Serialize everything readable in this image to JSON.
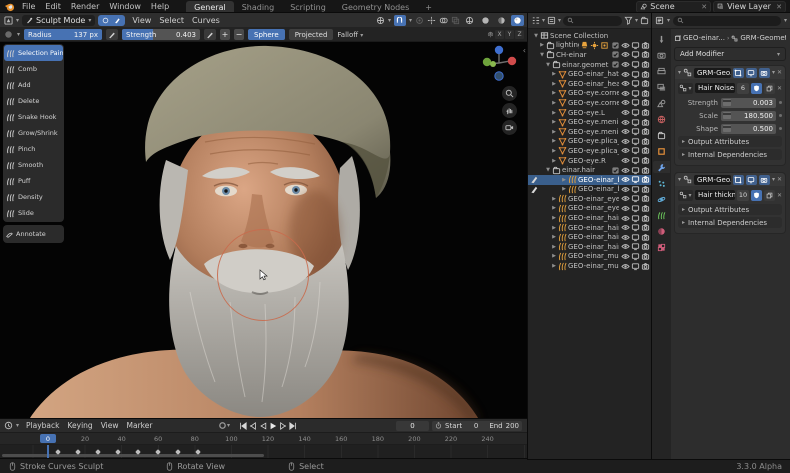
{
  "colors": {
    "accent": "#4772b3",
    "selection_row": "#3a5f8c",
    "brush_cursor": "#c96a4d",
    "object_orange": "#e8913a"
  },
  "topbar": {
    "menus": [
      "File",
      "Edit",
      "Render",
      "Window",
      "Help"
    ],
    "workspaces": [
      {
        "label": "General",
        "active": true
      },
      {
        "label": "Shading",
        "active": false
      },
      {
        "label": "Scripting",
        "active": false
      },
      {
        "label": "Geometry Nodes",
        "active": false
      },
      {
        "label": "+",
        "active": false
      }
    ],
    "scene": "Scene",
    "view_layer": "View Layer"
  },
  "viewport": {
    "mode": "Sculpt Mode",
    "menus": [
      "View",
      "Select",
      "Curves"
    ],
    "tool_settings": {
      "radius_label": "Radius",
      "radius_value": "137 px",
      "radius_fill": 1.0,
      "strength_label": "Strength",
      "strength_value": "0.403",
      "strength_fill": 0.4,
      "plus": "+",
      "minus": "−",
      "shape": "Sphere",
      "projection": "Projected",
      "falloff_label": "Falloff",
      "symmetry": [
        "X",
        "Y",
        "Z"
      ]
    },
    "toolbar": [
      {
        "label": "Selection Paint",
        "active": true
      },
      {
        "label": "Comb",
        "active": false
      },
      {
        "label": "Add",
        "active": false
      },
      {
        "label": "Delete",
        "active": false
      },
      {
        "label": "Snake Hook",
        "active": false
      },
      {
        "label": "Grow/Shrink",
        "active": false
      },
      {
        "label": "Pinch",
        "active": false
      },
      {
        "label": "Smooth",
        "active": false
      },
      {
        "label": "Puff",
        "active": false
      },
      {
        "label": "Density",
        "active": false
      },
      {
        "label": "Slide",
        "active": false
      }
    ],
    "annotate_tool": "Annotate"
  },
  "outliner": {
    "rows": [
      {
        "label": "Scene Collection",
        "depth": 0,
        "type": "scene",
        "arrow": "down",
        "toggles": 0,
        "lights": false,
        "selected": false,
        "mode_dot": false
      },
      {
        "label": "lighting",
        "depth": 1,
        "type": "collection",
        "arrow": "right",
        "toggles": 4,
        "lights": true,
        "selected": false,
        "mode_dot": false
      },
      {
        "label": "CH-einar",
        "depth": 1,
        "type": "collection",
        "arrow": "down",
        "toggles": 4,
        "lights": false,
        "selected": false,
        "mode_dot": false
      },
      {
        "label": "einar.geometry",
        "depth": 2,
        "type": "collection",
        "arrow": "down",
        "toggles": 4,
        "lights": false,
        "selected": false,
        "mode_dot": false
      },
      {
        "label": "GEO-einar_hat",
        "depth": 3,
        "type": "mesh",
        "arrow": "right",
        "toggles": 3,
        "lights": false,
        "selected": false,
        "mode_dot": false
      },
      {
        "label": "GEO-einar_heac",
        "depth": 3,
        "type": "mesh",
        "arrow": "right",
        "toggles": 3,
        "lights": false,
        "selected": false,
        "mode_dot": false
      },
      {
        "label": "GEO-eye.cornea",
        "depth": 3,
        "type": "mesh",
        "arrow": "right",
        "toggles": 3,
        "lights": false,
        "selected": false,
        "mode_dot": false
      },
      {
        "label": "GEO-eye.cornea",
        "depth": 3,
        "type": "mesh",
        "arrow": "right",
        "toggles": 3,
        "lights": false,
        "selected": false,
        "mode_dot": false
      },
      {
        "label": "GEO-eye.L",
        "depth": 3,
        "type": "mesh",
        "arrow": "right",
        "toggles": 3,
        "lights": false,
        "selected": false,
        "mode_dot": false
      },
      {
        "label": "GEO-eye.menis",
        "depth": 3,
        "type": "mesh",
        "arrow": "right",
        "toggles": 3,
        "lights": false,
        "selected": false,
        "mode_dot": false
      },
      {
        "label": "GEO-eye.menis",
        "depth": 3,
        "type": "mesh",
        "arrow": "right",
        "toggles": 3,
        "lights": false,
        "selected": false,
        "mode_dot": false
      },
      {
        "label": "GEO-eye.plica_s",
        "depth": 3,
        "type": "mesh",
        "arrow": "right",
        "toggles": 3,
        "lights": false,
        "selected": false,
        "mode_dot": false
      },
      {
        "label": "GEO-eye.plica_s",
        "depth": 3,
        "type": "mesh",
        "arrow": "right",
        "toggles": 3,
        "lights": false,
        "selected": false,
        "mode_dot": false
      },
      {
        "label": "GEO-eye.R",
        "depth": 3,
        "type": "mesh",
        "arrow": "right",
        "toggles": 3,
        "lights": false,
        "selected": false,
        "mode_dot": false
      },
      {
        "label": "einar.hair",
        "depth": 2,
        "type": "collection",
        "arrow": "down",
        "toggles": 4,
        "lights": false,
        "selected": false,
        "mode_dot": false
      },
      {
        "label": "GEO-einar_bear",
        "depth": 3,
        "type": "hair",
        "arrow": "right",
        "toggles": 3,
        "lights": false,
        "selected": true,
        "mode_dot": true
      },
      {
        "label": "GEO-einar_bear",
        "depth": 3,
        "type": "hair",
        "arrow": "right",
        "toggles": 3,
        "lights": false,
        "selected": false,
        "mode_dot": true
      },
      {
        "label": "GEO-einar_eyeb",
        "depth": 3,
        "type": "hair",
        "arrow": "right",
        "toggles": 3,
        "lights": false,
        "selected": false,
        "mode_dot": false
      },
      {
        "label": "GEO-einar_eyeb",
        "depth": 3,
        "type": "hair",
        "arrow": "right",
        "toggles": 3,
        "lights": false,
        "selected": false,
        "mode_dot": false
      },
      {
        "label": "GEO-einar_hair",
        "depth": 3,
        "type": "hair",
        "arrow": "right",
        "toggles": 3,
        "lights": false,
        "selected": false,
        "mode_dot": false
      },
      {
        "label": "GEO-einar_hair",
        "depth": 3,
        "type": "hair",
        "arrow": "right",
        "toggles": 3,
        "lights": false,
        "selected": false,
        "mode_dot": false
      },
      {
        "label": "GEO-einar_hair",
        "depth": 3,
        "type": "hair",
        "arrow": "right",
        "toggles": 3,
        "lights": false,
        "selected": false,
        "mode_dot": false
      },
      {
        "label": "GEO-einar_hair",
        "depth": 3,
        "type": "hair",
        "arrow": "right",
        "toggles": 3,
        "lights": false,
        "selected": false,
        "mode_dot": false
      },
      {
        "label": "GEO-einar_must",
        "depth": 3,
        "type": "hair",
        "arrow": "right",
        "toggles": 3,
        "lights": false,
        "selected": false,
        "mode_dot": false
      },
      {
        "label": "GEO-einar_must",
        "depth": 3,
        "type": "hair",
        "arrow": "right",
        "toggles": 3,
        "lights": false,
        "selected": false,
        "mode_dot": false
      }
    ]
  },
  "properties": {
    "breadcrumb": {
      "object": "GEO-einar...",
      "modifier": "GRM-Geometr..."
    },
    "add_modifier": "Add Modifier",
    "modifiers": [
      {
        "name": "GRM-Geo...",
        "node_group": "Hair Noise",
        "users": "6",
        "params": [
          {
            "label": "Strength",
            "value": "0.003"
          },
          {
            "label": "Scale",
            "value": "180.500"
          },
          {
            "label": "Shape",
            "value": "0.500"
          }
        ],
        "sections": [
          "Output Attributes",
          "Internal Dependencies"
        ]
      },
      {
        "name": "GRM-Geo...",
        "node_group": "Hair thickness",
        "users": "10",
        "params": [],
        "sections": [
          "Output Attributes",
          "Internal Dependencies"
        ]
      }
    ]
  },
  "timeline": {
    "menus": [
      "Playback",
      "Keying",
      "View",
      "Marker"
    ],
    "current_frame": "0",
    "start_label": "Start",
    "start_value": "0",
    "end_label": "End",
    "end_value": "200",
    "ruler_ticks": [
      "20",
      "40",
      "60",
      "80",
      "100",
      "120",
      "140",
      "160",
      "180",
      "200",
      "220",
      "240"
    ],
    "playhead_label": "0"
  },
  "statusbar": {
    "hints": [
      "Stroke Curves Sculpt",
      "Rotate View",
      "Select"
    ],
    "version": "3.3.0 Alpha"
  }
}
